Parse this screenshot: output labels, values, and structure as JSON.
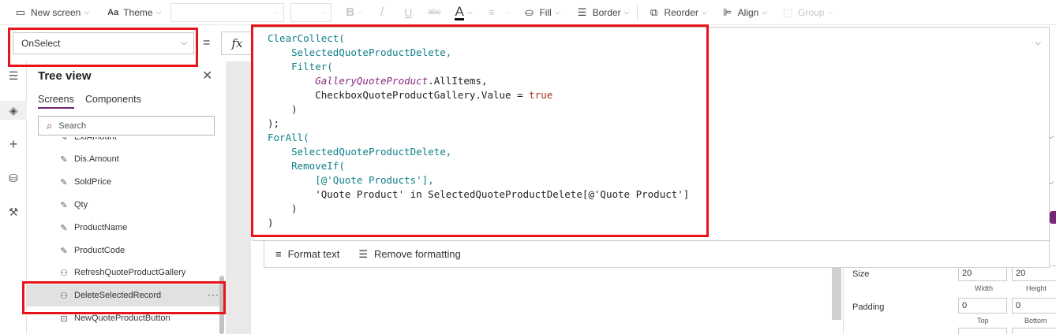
{
  "toolbar": {
    "new_screen": "New screen",
    "theme": "Theme",
    "bold": "B",
    "italic": "/",
    "underline": "U",
    "strike": "abc",
    "font_color": "A",
    "fill": "Fill",
    "border": "Border",
    "reorder": "Reorder",
    "align": "Align",
    "group": "Group"
  },
  "formula_bar": {
    "property": "OnSelect",
    "equals": "=",
    "fx": "fx",
    "code_lines": [
      [
        {
          "t": "ClearCollect(",
          "c": "k-fn"
        }
      ],
      [
        {
          "t": "    ",
          "c": "k-plain"
        },
        {
          "t": "SelectedQuoteProductDelete,",
          "c": "k-fn"
        }
      ],
      [
        {
          "t": "    ",
          "c": "k-plain"
        },
        {
          "t": "Filter(",
          "c": "k-fn"
        }
      ],
      [
        {
          "t": "        ",
          "c": "k-plain"
        },
        {
          "t": "GalleryQuoteProduct",
          "c": "k-gal"
        },
        {
          "t": ".AllItems,",
          "c": "k-plain"
        }
      ],
      [
        {
          "t": "        CheckboxQuoteProductGallery.Value = ",
          "c": "k-plain"
        },
        {
          "t": "true",
          "c": "k-bool"
        }
      ],
      [
        {
          "t": "    )",
          "c": "k-plain"
        }
      ],
      [
        {
          "t": ");",
          "c": "k-plain"
        }
      ],
      [
        {
          "t": "ForAll(",
          "c": "k-fn"
        }
      ],
      [
        {
          "t": "    ",
          "c": "k-plain"
        },
        {
          "t": "SelectedQuoteProductDelete,",
          "c": "k-fn"
        }
      ],
      [
        {
          "t": "    ",
          "c": "k-plain"
        },
        {
          "t": "RemoveIf(",
          "c": "k-fn"
        }
      ],
      [
        {
          "t": "        ",
          "c": "k-plain"
        },
        {
          "t": "[@'Quote Products'],",
          "c": "k-str"
        }
      ],
      [
        {
          "t": "        'Quote Product' in SelectedQuoteProductDelete[@'Quote Product']",
          "c": "k-plain"
        }
      ],
      [
        {
          "t": "    )",
          "c": "k-plain"
        }
      ],
      [
        {
          "t": ")",
          "c": "k-plain"
        }
      ]
    ],
    "format_text": "Format text",
    "remove_formatting": "Remove formatting"
  },
  "tree_view": {
    "title": "Tree view",
    "tabs": [
      "Screens",
      "Components"
    ],
    "search_placeholder": "Search",
    "items": [
      {
        "label": "ExtAmount",
        "icon": "edit-icon"
      },
      {
        "label": "Dis.Amount",
        "icon": "edit-icon"
      },
      {
        "label": "SoldPrice",
        "icon": "edit-icon"
      },
      {
        "label": "Qty",
        "icon": "edit-icon"
      },
      {
        "label": "ProductName",
        "icon": "edit-icon"
      },
      {
        "label": "ProductCode",
        "icon": "edit-icon"
      },
      {
        "label": "RefreshQuoteProductGallery",
        "icon": "icon-control-icon"
      },
      {
        "label": "DeleteSelectedRecord",
        "icon": "icon-control-icon",
        "selected": true
      },
      {
        "label": "NewQuoteProductButton",
        "icon": "button-icon"
      }
    ],
    "more": "···"
  },
  "properties": {
    "size_label": "Size",
    "size_width": "20",
    "size_height": "20",
    "width_label": "Width",
    "height_label": "Height",
    "padding_label": "Padding",
    "padding_top": "0",
    "padding_bottom": "0",
    "top_label": "Top",
    "bottom_label": "Bottom"
  },
  "colors": {
    "accent": "#742774",
    "highlight": "#e8141a",
    "function": "#0e7f8a",
    "gallery": "#8a2c80",
    "boolean": "#a8321b"
  }
}
